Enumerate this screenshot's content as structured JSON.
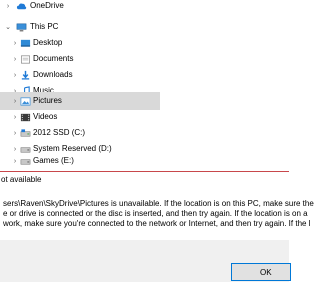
{
  "nav": {
    "items": [
      {
        "label": "OneDrive",
        "icon": "cloud-icon"
      },
      {
        "label": "This PC",
        "icon": "computer-icon"
      },
      {
        "label": "Desktop",
        "icon": "desktop-folder-icon"
      },
      {
        "label": "Documents",
        "icon": "documents-folder-icon"
      },
      {
        "label": "Downloads",
        "icon": "downloads-folder-icon"
      },
      {
        "label": "Music",
        "icon": "music-folder-icon"
      },
      {
        "label": "Pictures",
        "icon": "pictures-folder-icon"
      },
      {
        "label": "Videos",
        "icon": "videos-folder-icon"
      },
      {
        "label": "2012 SSD (C:)",
        "icon": "drive-c-icon"
      },
      {
        "label": "System Reserved (D:)",
        "icon": "drive-d-icon"
      },
      {
        "label": "Games (E:)",
        "icon": "drive-e-icon"
      }
    ],
    "selected": "Pictures"
  },
  "dialog": {
    "title": "ot available",
    "message_lines": [
      "sers\\Raven\\SkyDrive\\Pictures is unavailable. If the location is on this PC, make sure the",
      "e or drive is connected or the disc is inserted, and then try again. If the location is on a",
      "work, make sure you're connected to the network or Internet, and then try again. If the l"
    ],
    "ok_label": "OK"
  },
  "colors": {
    "selection": "#d9d9d9",
    "dialog_border": "#c8474b",
    "button_border": "#0078d7",
    "folder": "#e8b94a"
  }
}
